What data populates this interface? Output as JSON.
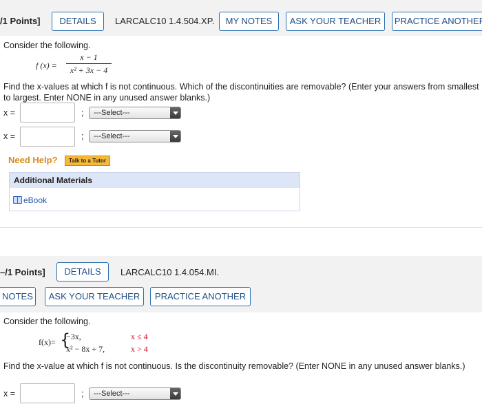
{
  "problem1": {
    "points": "/1 Points]",
    "buttons": {
      "details": "DETAILS",
      "my_notes": "MY NOTES",
      "ask_teacher": "ASK YOUR TEACHER",
      "practice": "PRACTICE ANOTHER"
    },
    "code": "LARCALC10 1.4.504.XP.",
    "consider": "Consider the following.",
    "func_lhs": "f (x) =",
    "numerator": "x − 1",
    "denominator": "x² + 3x − 4",
    "instructions": "Find the x-values at which f is not continuous. Which of the discontinuities are removable? (Enter your answers from smallest to largest. Enter NONE in any unused answer blanks.)",
    "answers": [
      {
        "label": "x =",
        "value": "",
        "sep": ";",
        "select": "---Select---"
      },
      {
        "label": "x =",
        "value": "",
        "sep": ";",
        "select": "---Select---"
      }
    ],
    "need_help": "Need Help?",
    "tutor": "Talk to a Tutor",
    "materials_title": "Additional Materials",
    "ebook": "eBook"
  },
  "problem2": {
    "points": "–/1 Points]",
    "buttons": {
      "details": "DETAILS",
      "notes": "NOTES",
      "ask_teacher": "ASK YOUR TEACHER",
      "practice": "PRACTICE ANOTHER"
    },
    "code": "LARCALC10 1.4.054.MI.",
    "consider": "Consider the following.",
    "func_lhs": "f(x)=",
    "case1_expr": "−3x,",
    "case1_cond": "x ≤ 4",
    "case2_expr": "x² − 8x + 7,",
    "case2_cond": "x > 4",
    "instructions": "Find the x-value at which f is not continuous. Is the discontinuity removable? (Enter NONE in any unused answer blanks.)",
    "answer": {
      "label": "x =",
      "value": "",
      "sep": ";",
      "select": "---Select---"
    }
  },
  "colors": {
    "button_border": "#2a6fb0",
    "button_text": "#1e4e86",
    "need_help": "#d98a1a",
    "tutor_bg": "#f6b836",
    "materials_header": "#dde6f6",
    "link": "#1f57a8",
    "red_value": "#d0021b"
  }
}
